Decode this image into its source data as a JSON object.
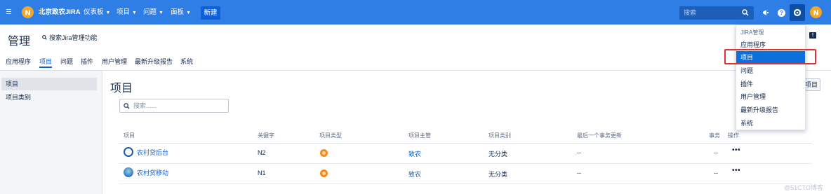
{
  "topbar": {
    "brand": "北京致农JIRA",
    "menus": [
      "仪表板",
      "项目",
      "问题",
      "面板"
    ],
    "create_label": "新建",
    "search_placeholder": "搜索"
  },
  "header": {
    "title": "管理",
    "admin_search": "搜索Jira管理功能"
  },
  "tabs": [
    "应用程序",
    "项目",
    "问题",
    "插件",
    "用户管理",
    "最新升级报告",
    "系统"
  ],
  "sidebar": {
    "items": [
      "项目",
      "项目类别"
    ]
  },
  "main": {
    "title": "项目",
    "search_placeholder": "搜索......",
    "right_button_fragment": "项目",
    "columns": [
      "项目",
      "关键字",
      "项目类型",
      "项目主管",
      "项目类别",
      "最后一个事务更新",
      "事务",
      "操作"
    ],
    "rows": [
      {
        "name": "农村贷后台",
        "key": "N2",
        "lead": "致农",
        "category": "无分类",
        "last_update": "--",
        "issues": "--",
        "actions": "•••"
      },
      {
        "name": "农村贷移动",
        "key": "N1",
        "lead": "致农",
        "category": "无分类",
        "last_update": "--",
        "issues": "--",
        "actions": "•••"
      }
    ]
  },
  "dropdown": {
    "title": "JIRA管理",
    "items": [
      "应用程序",
      "项目",
      "问题",
      "插件",
      "用户管理",
      "最新升级报告",
      "系统"
    ]
  },
  "watermark": "@51CTO博客",
  "colors": {
    "topbar": "#2f7ee6",
    "accent": "#0b5fd6",
    "highlight": "#e03131",
    "logo": "#f5a623"
  }
}
